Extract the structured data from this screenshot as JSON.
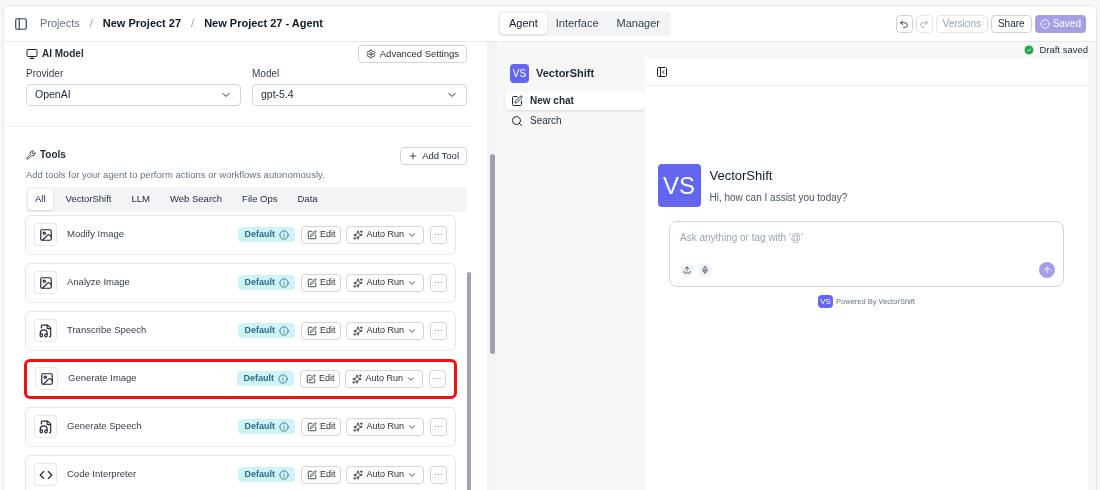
{
  "breadcrumb": [
    {
      "label": "Projects"
    },
    {
      "separator": "/",
      "label": "New Project 27"
    },
    {
      "separator": "/",
      "label": "New Project 27 - Agent"
    }
  ],
  "mode_tabs": [
    {
      "label": "Agent",
      "selected": true
    },
    {
      "label": "Interface",
      "selected": false
    },
    {
      "label": "Manager",
      "selected": false
    }
  ],
  "toolbar": {
    "versions": "Versions",
    "share": "Share",
    "saved": "Saved"
  },
  "ai_model": {
    "title": "AI Model",
    "advanced": "Advanced Settings",
    "provider_label": "Provider",
    "provider": "OpenAI",
    "model_label": "Model",
    "model": "gpt-5.4"
  },
  "tools": {
    "title": "Tools",
    "add": "Add Tool",
    "description": "Add tools for your agent to perform actions or workflows autonomously.",
    "filters": [
      {
        "label": "All",
        "selected": true
      },
      {
        "label": "VectorShift",
        "selected": false
      },
      {
        "label": "LLM",
        "selected": false
      },
      {
        "label": "Web Search",
        "selected": false
      },
      {
        "label": "File Ops",
        "selected": false
      },
      {
        "label": "Data",
        "selected": false
      }
    ],
    "items": [
      {
        "name": "Modify Image",
        "kind": "image",
        "badge": "Default",
        "edit": "Edit",
        "run": "Auto Run",
        "more": "···",
        "highlighted": false
      },
      {
        "name": "Analyze Image",
        "kind": "image",
        "badge": "Default",
        "edit": "Edit",
        "run": "Auto Run",
        "more": "···",
        "highlighted": false
      },
      {
        "name": "Transcribe Speech",
        "kind": "speech",
        "badge": "Default",
        "edit": "Edit",
        "run": "Auto Run",
        "more": "···",
        "highlighted": false
      },
      {
        "name": "Generate Image",
        "kind": "image",
        "badge": "Default",
        "edit": "Edit",
        "run": "Auto Run",
        "more": "···",
        "highlighted": true
      },
      {
        "name": "Generate Speech",
        "kind": "speech",
        "badge": "Default",
        "edit": "Edit",
        "run": "Auto Run",
        "more": "···",
        "highlighted": false
      },
      {
        "name": "Code Interpreter",
        "kind": "code",
        "badge": "Default",
        "edit": "Edit",
        "run": "Auto Run",
        "more": "···",
        "highlighted": false
      }
    ]
  },
  "status": "Draft saved",
  "chat": {
    "logo": "VS",
    "brand": "VectorShift",
    "nav": [
      {
        "label": "New chat",
        "kind": "new",
        "selected": true
      },
      {
        "label": "Search",
        "kind": "search",
        "selected": false
      }
    ],
    "welcome_logo": "VS",
    "welcome_title": "VectorShift",
    "welcome_text": "Hi, how can I assist you today?",
    "placeholder": "Ask anything or tag with '@'",
    "powered_logo": "VS",
    "powered": "Powered By VectorShift"
  }
}
